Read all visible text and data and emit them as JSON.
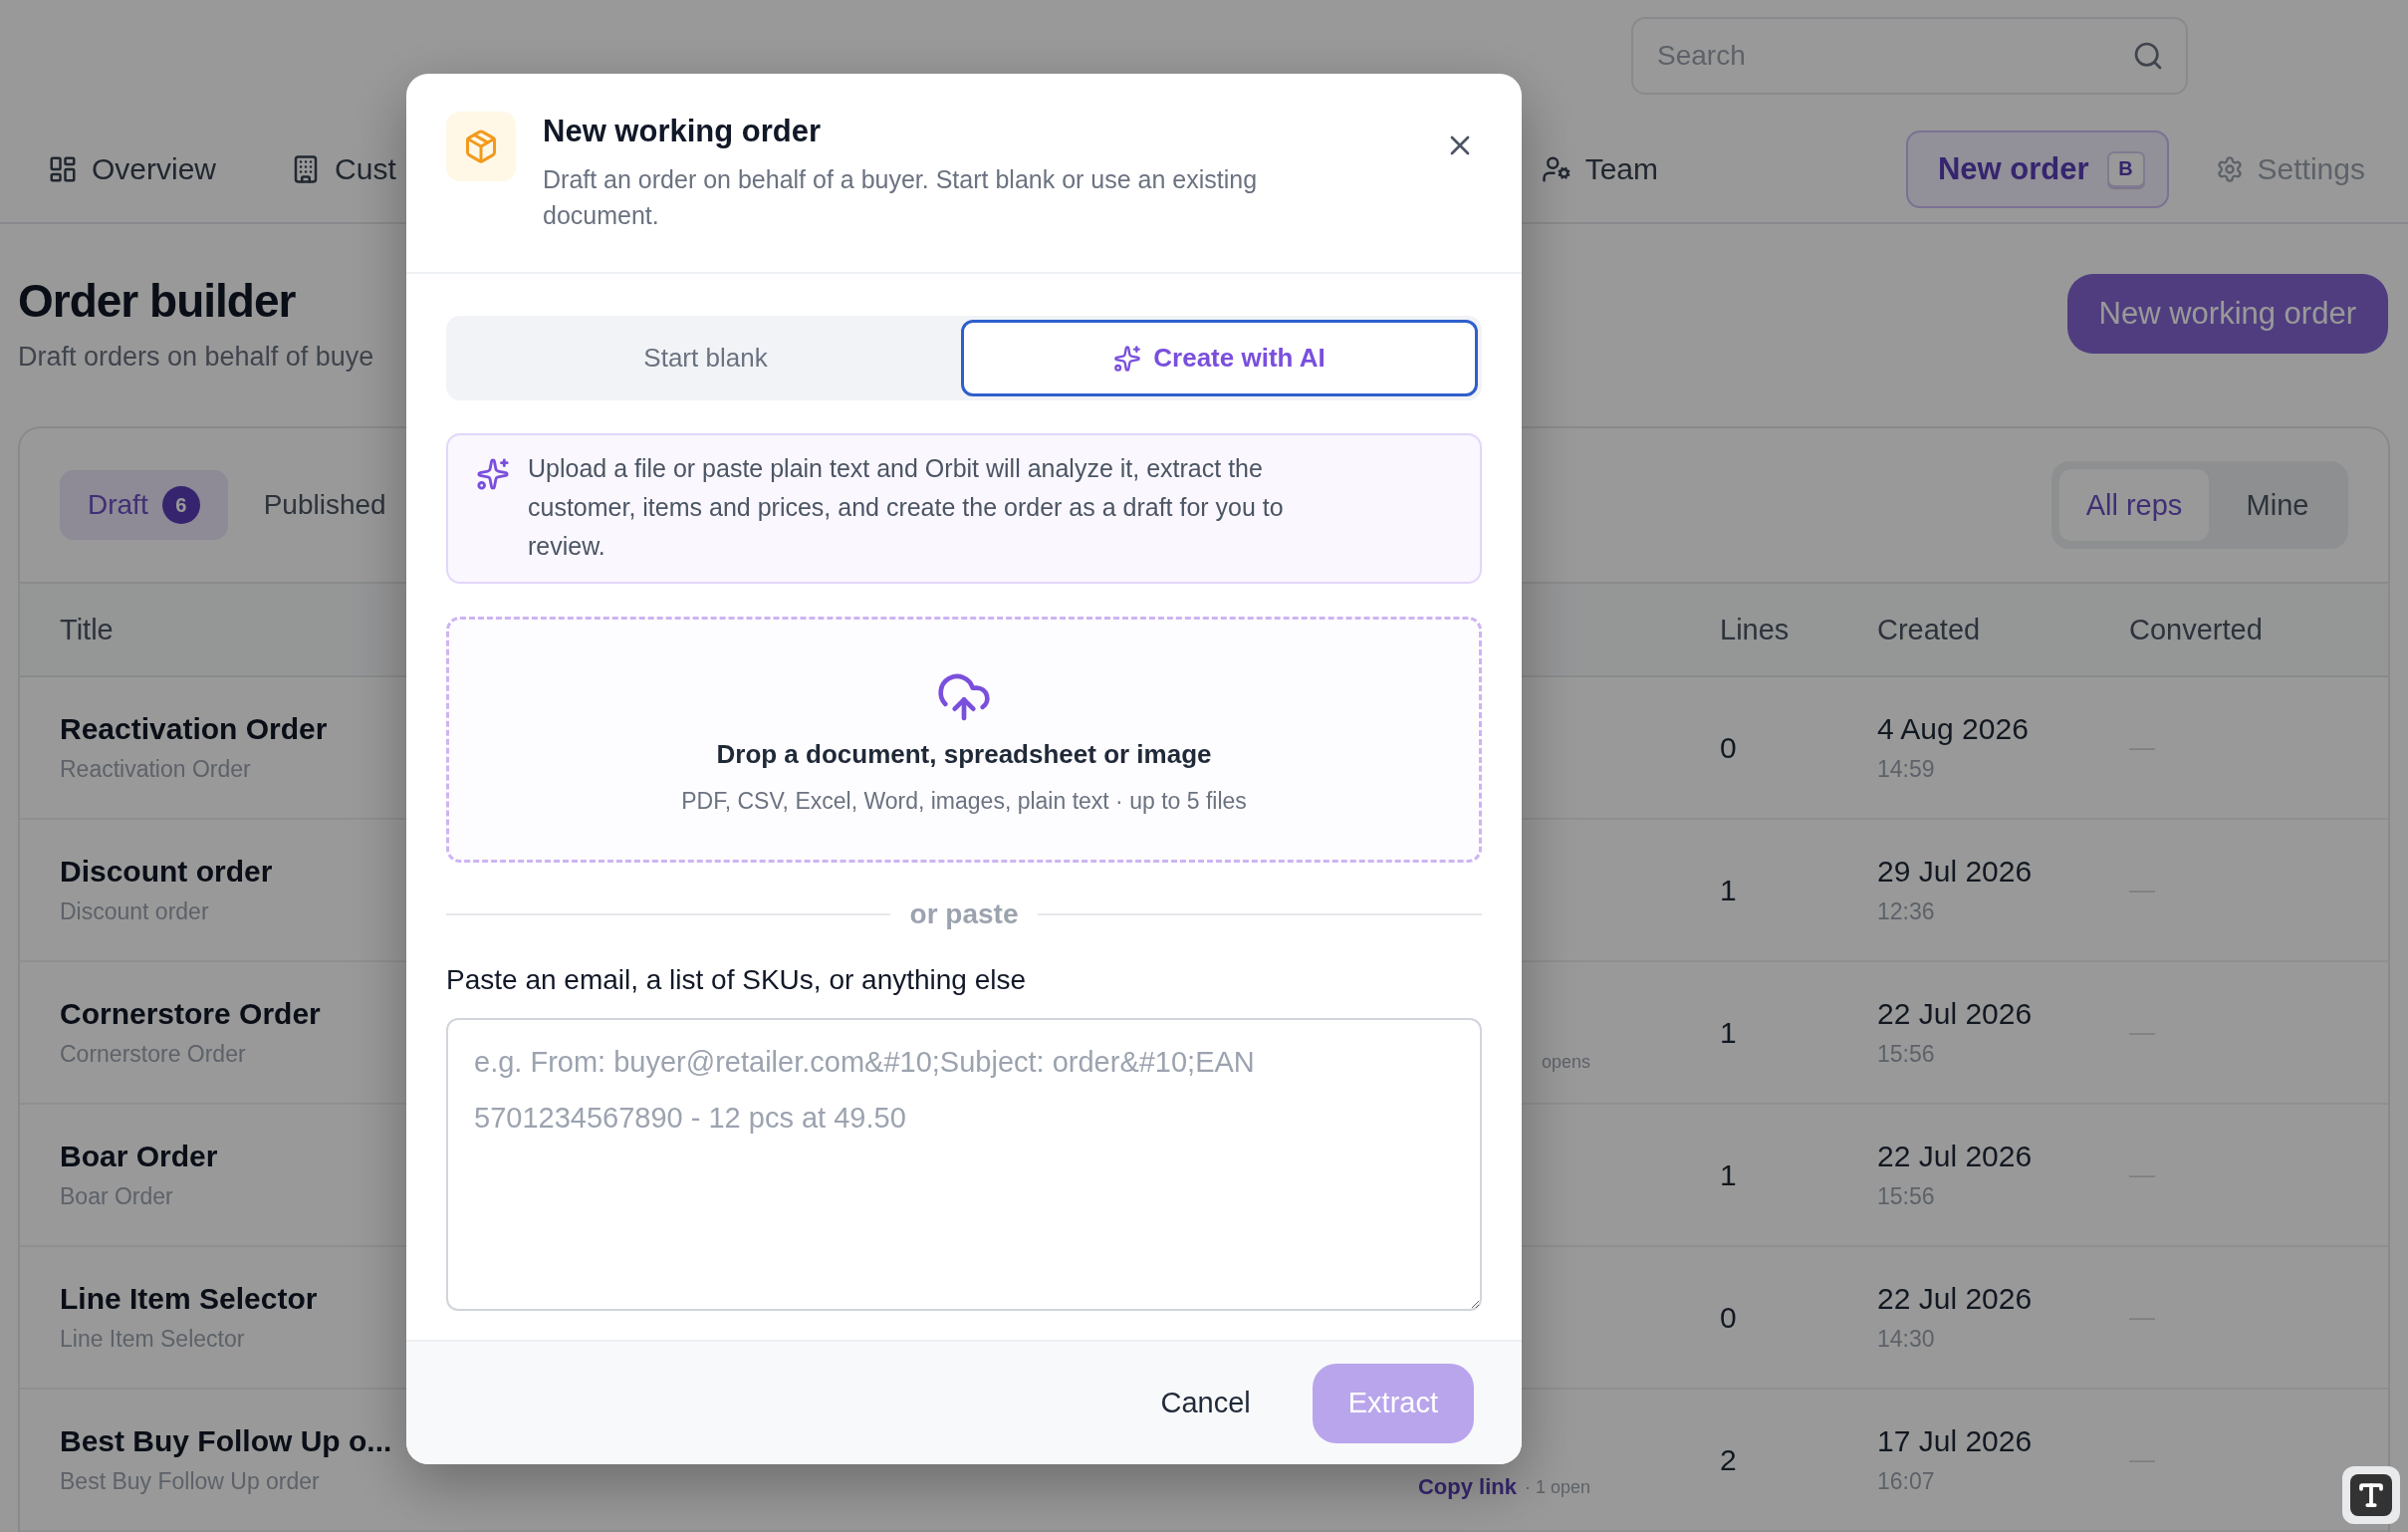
{
  "nav": {
    "search": {
      "placeholder": "Search"
    },
    "items": [
      {
        "label": "Overview"
      },
      {
        "label": "Cust"
      },
      {
        "label": "Team"
      }
    ],
    "new_order": {
      "label": "New order",
      "shortcut": "B"
    },
    "settings": {
      "label": "Settings"
    }
  },
  "page": {
    "title": "Order builder",
    "subtitle": "Draft orders on behalf of buye",
    "primary_button": "New working order"
  },
  "orders": {
    "tabs": [
      {
        "label": "Draft",
        "count": "6",
        "selected": true
      },
      {
        "label": "Published",
        "selected": false
      }
    ],
    "filters": [
      {
        "label": "All reps",
        "selected": true
      },
      {
        "label": "Mine",
        "selected": false
      }
    ],
    "columns": {
      "title": "Title",
      "lines": "Lines",
      "created": "Created",
      "converted": "Converted"
    },
    "rows": [
      {
        "title": "Reactivation Order",
        "subtitle": "Reactivation Order",
        "lines": "0",
        "date": "4 Aug 2026",
        "time": "14:59",
        "converted": "—"
      },
      {
        "title": "Discount order",
        "subtitle": "Discount order",
        "lines": "1",
        "date": "29 Jul 2026",
        "time": "12:36",
        "converted": "—"
      },
      {
        "title": "Cornerstore Order",
        "subtitle": "Cornerstore Order",
        "link_note": "opens",
        "lines": "1",
        "date": "22 Jul 2026",
        "time": "15:56",
        "converted": "—"
      },
      {
        "title": "Boar Order",
        "subtitle": "Boar Order",
        "lines": "1",
        "date": "22 Jul 2026",
        "time": "15:56",
        "converted": "—"
      },
      {
        "title": "Line Item Selector",
        "subtitle": "Line Item Selector",
        "lines": "0",
        "date": "22 Jul 2026",
        "time": "14:30",
        "converted": "—"
      },
      {
        "title": "Best Buy Follow Up o...",
        "subtitle": "Best Buy Follow Up order",
        "link": "Copy link",
        "link_note": "· 1 open",
        "lines": "2",
        "date": "17 Jul 2026",
        "time": "16:07",
        "converted": "—"
      }
    ]
  },
  "dialog": {
    "title": "New working order",
    "description": "Draft an order on behalf of a buyer. Start blank or use an existing document.",
    "modes": [
      {
        "label": "Start blank",
        "kind": "blank",
        "selected": false
      },
      {
        "label": "Create with AI",
        "kind": "ai",
        "selected": true
      }
    ],
    "info": "Upload a file or paste plain text and Orbit will analyze it, extract the customer, items and prices, and create the order as a draft for you to review.",
    "dropzone": {
      "title": "Drop a document, spreadsheet or image",
      "hint": "PDF, CSV, Excel, Word, images, plain text · up to 5 files"
    },
    "divider": "or paste",
    "paste": {
      "label": "Paste an email, a list of SKUs, or anything else",
      "placeholder": "e.g. From: buyer@retailer.com&#10;Subject: order&#10;EAN 5701234567890 - 12 pcs at 49.50"
    },
    "cancel": "Cancel",
    "submit": {
      "label": "Extract",
      "disabled": true
    }
  }
}
